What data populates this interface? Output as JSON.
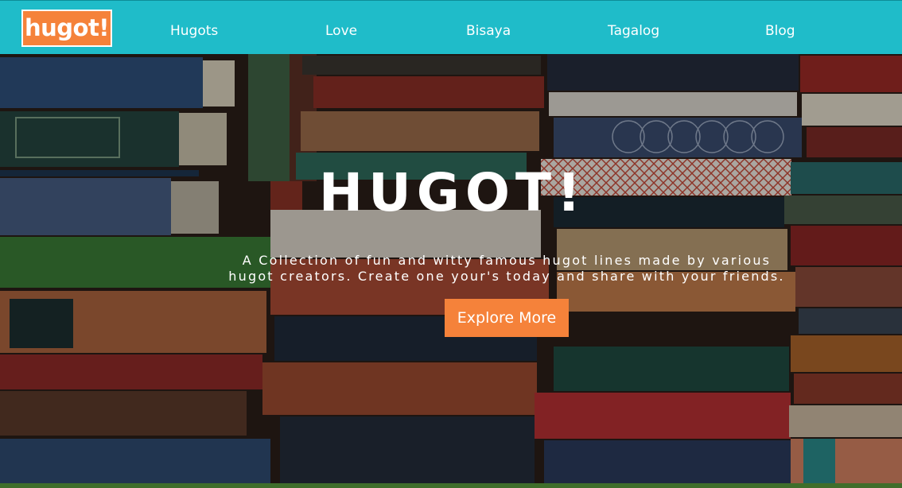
{
  "brand": {
    "logo_text": "hugot!"
  },
  "nav": {
    "items": [
      {
        "label": "Hugots"
      },
      {
        "label": "Love"
      },
      {
        "label": "Bisaya"
      },
      {
        "label": "Tagalog"
      },
      {
        "label": "Blog"
      }
    ]
  },
  "hero": {
    "title": "HUGOT!",
    "subtitle_line1": "A Collection of fun and witty famous hugot lines made by various",
    "subtitle_line2": "hugot creators. Create one your's today and share with your friends.",
    "cta_label": "Explore More"
  },
  "colors": {
    "navbar_bg": "#1fbcc9",
    "accent_orange": "#f5823a",
    "text": "#ffffff"
  }
}
